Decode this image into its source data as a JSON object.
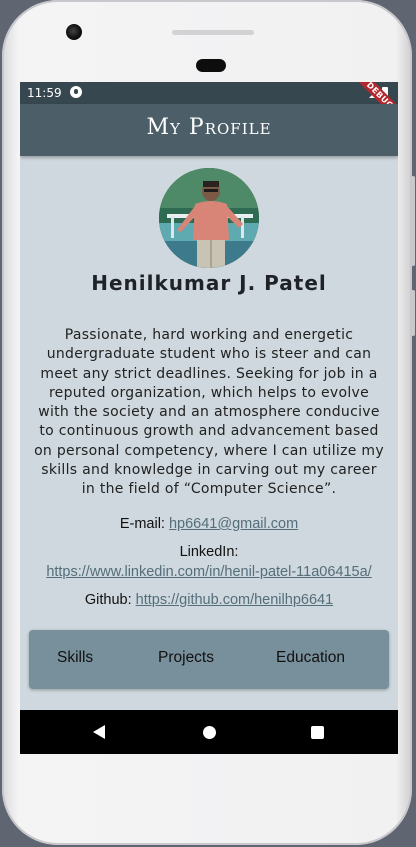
{
  "status_bar": {
    "time": "11:59",
    "debug_label": "DEBUG"
  },
  "app_bar": {
    "title": "My Profile"
  },
  "profile": {
    "name": "Henilkumar J. Patel",
    "bio": "Passionate, hard working and energetic undergraduate student who is steer and can meet any strict deadlines. Seeking for job in a reputed organization, which helps to evolve with the society and an atmosphere conducive to continuous growth and advancement based on personal competency, where I can utilize my skills and knowledge in carving out my career in the field of “Computer Science”."
  },
  "contact": {
    "email_label": "E-mail: ",
    "email": "hp6641@gmail.com",
    "linkedin_label": "LinkedIn:",
    "linkedin": "https://www.linkedin.com/in/henil-patel-11a06415a/",
    "github_label": "Github: ",
    "github": "https://github.com/henilhp6641"
  },
  "tabs": [
    {
      "label": "Skills"
    },
    {
      "label": "Projects"
    },
    {
      "label": "Education"
    }
  ],
  "colors": {
    "app_bar": "#4c5f69",
    "status_bar": "#37474f",
    "background": "#ced8de",
    "tab_bar": "#78909c",
    "link": "#546e7a"
  },
  "nav_icons": [
    "back-icon",
    "home-icon",
    "recents-icon"
  ]
}
